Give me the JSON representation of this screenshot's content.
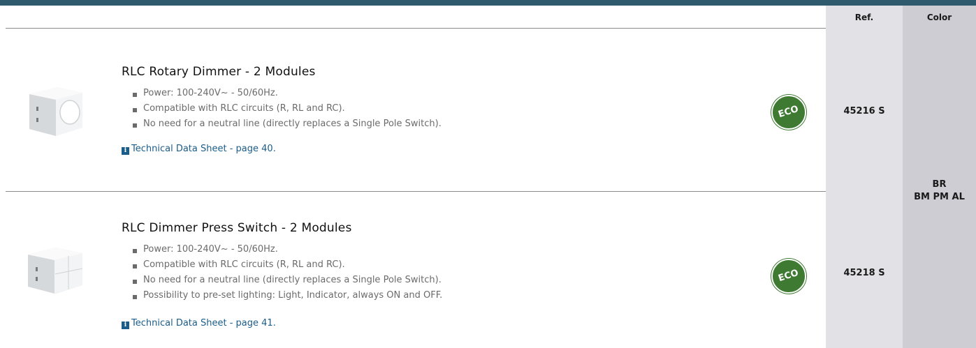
{
  "table": {
    "ref_header": "Ref.",
    "color_header": "Color",
    "color_value_line1": "BR",
    "color_value_line2": "BM PM AL"
  },
  "products": [
    {
      "title": "RLC Rotary Dimmer - 2 Modules",
      "bullets": [
        "Power: 100-240V~ - 50/60Hz.",
        "Compatible with RLC circuits (R, RL and RC).",
        "No need for a neutral line (directly replaces a Single Pole Switch)."
      ],
      "link_text": "Technical Data Sheet - page 40",
      "link_suffix": ".",
      "badge": "ECO",
      "ref": "45216 S",
      "icon": "rotary-dimmer-image"
    },
    {
      "title": "RLC Dimmer Press Switch - 2 Modules",
      "bullets": [
        "Power: 100-240V~ - 50/60Hz.",
        "Compatible with RLC circuits (R, RL and RC).",
        "No need for a neutral line (directly replaces a Single Pole Switch).",
        "Possibility to pre-set lighting: Light, Indicator, always ON and OFF."
      ],
      "link_text": "Technical Data Sheet - page 41",
      "link_suffix": ".",
      "badge": "ECO",
      "ref": "45218 S",
      "icon": "press-switch-image"
    }
  ],
  "info_icon_glyph": "i",
  "colors": {
    "header_bar": "#2f5a6e",
    "ref_column": "#e1e1e6",
    "color_column": "#cdcdd3",
    "eco_green": "#3f7a33",
    "link_blue": "#1b5d8a"
  }
}
